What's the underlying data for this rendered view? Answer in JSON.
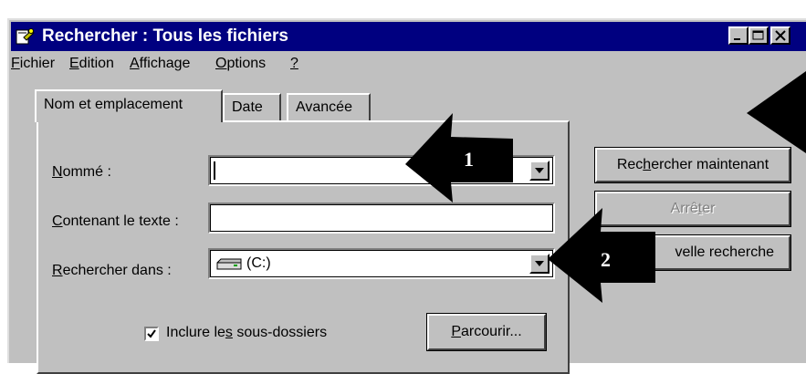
{
  "window": {
    "title": "Rechercher : Tous les fichiers",
    "icon": "search-flashlight-icon"
  },
  "menu": [
    {
      "mnemonic": "F",
      "rest": "ichier"
    },
    {
      "mnemonic": "E",
      "rest": "dition"
    },
    {
      "mnemonic": "A",
      "rest": "ffichage"
    },
    {
      "mnemonic": "O",
      "rest": "ptions"
    },
    {
      "mnemonic": "?",
      "rest": ""
    }
  ],
  "tabs": [
    {
      "label": "Nom et emplacement",
      "active": true
    },
    {
      "label": "Date",
      "active": false
    },
    {
      "label": "Avancée",
      "active": false
    }
  ],
  "form": {
    "named": {
      "mnemonic": "N",
      "rest": "ommé :",
      "value": ""
    },
    "contains": {
      "mnemonic": "C",
      "rest": "ontenant le texte :",
      "value": ""
    },
    "look_in": {
      "mnemonic": "R",
      "rest": "echercher dans :",
      "value": "(C:)",
      "icon": "hard-drive-icon"
    },
    "include_subfolders": {
      "before": "Inclure le",
      "mnemonic": "s",
      "after": " sous-dossiers",
      "checked": true
    },
    "browse_button": {
      "mnemonic": "P",
      "rest": "arcourir..."
    }
  },
  "buttons": {
    "search_now": {
      "before": "Rec",
      "mnemonic": "h",
      "after": "ercher maintenant"
    },
    "stop": {
      "before": "Arrê",
      "mnemonic": "t",
      "after": "er",
      "disabled": true
    },
    "new_search": {
      "label": "Nouvelle recherche",
      "visible_fragment": "velle recherche"
    }
  },
  "callouts": [
    {
      "number": "1"
    },
    {
      "number": "2"
    }
  ],
  "colors": {
    "titlebar": "#000080",
    "face": "#c0c0c0",
    "arrow": "#000000"
  }
}
